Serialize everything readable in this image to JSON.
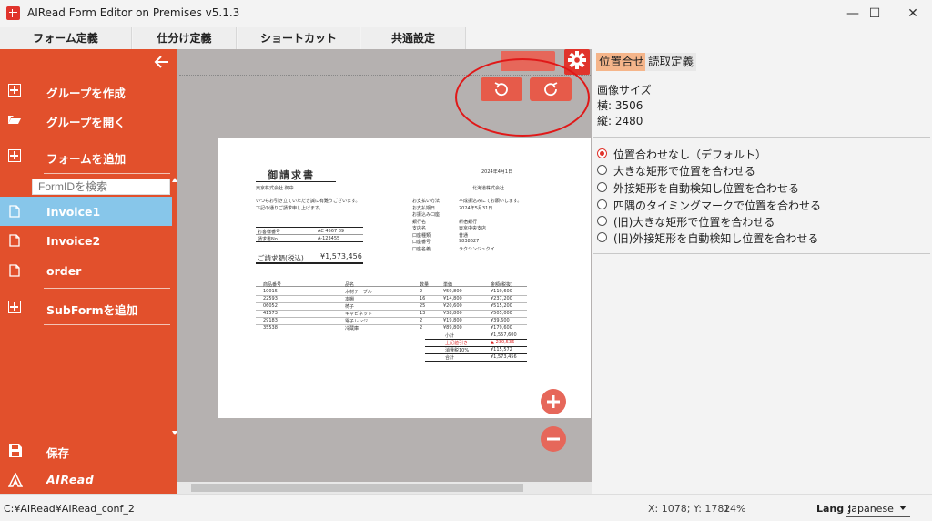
{
  "window": {
    "title": "AIRead Form Editor on Premises v5.1.3",
    "minimize": "—",
    "maximize": "☐",
    "close": "✕"
  },
  "menu": {
    "tabs": [
      "フォーム定義",
      "仕分け定義",
      "ショートカット",
      "共通設定"
    ]
  },
  "sidebar": {
    "back_icon": "arrow-left-icon",
    "items": [
      {
        "label": "グループを作成",
        "icon": "plus-box-icon"
      },
      {
        "label": "グループを開く",
        "icon": "folder-open-icon"
      },
      {
        "label": "フォームを追加",
        "icon": "plus-box-icon"
      },
      {
        "label": "Invoice1",
        "icon": "document-icon"
      },
      {
        "label": "Invoice2",
        "icon": "document-icon"
      },
      {
        "label": "order",
        "icon": "document-icon"
      },
      {
        "label": "SubFormを追加",
        "icon": "plus-box-icon"
      }
    ],
    "search_placeholder": "FormIDを検索",
    "selected": "Invoice1",
    "save_label": "保存",
    "brand": "AIRead"
  },
  "canvas": {
    "rotate_left_icon": "rotate-left-icon",
    "rotate_right_icon": "rotate-right-icon",
    "zoom_in_icon": "plus-circle-icon",
    "zoom_out_icon": "minus-circle-icon",
    "settings_icon": "gear-icon",
    "document": {
      "title": "御請求書",
      "date": "2024年4月1日",
      "customer": "東京株式会社 御中",
      "issuer": "北海道株式会社",
      "greeting": [
        "いつもお引き立ていただき誠に有難うございます。",
        "下記の通りご請求申し上げます。"
      ],
      "meta_left": [
        [
          "お客様番号",
          "AC 4567 89"
        ],
        [
          "請求書No",
          "A-123455"
        ]
      ],
      "meta_right": [
        [
          "お支払い方法",
          "平成振込みにてお願いします。"
        ],
        [
          "お支払期日",
          "2024年5月31日"
        ],
        [
          "お振込み口座",
          ""
        ],
        [
          "銀行名",
          "新宿銀行"
        ],
        [
          "支店名",
          "東京中央支店"
        ],
        [
          "口座種類",
          "普通"
        ],
        [
          "口座番号",
          "9838627"
        ],
        [
          "口座名義",
          "ラクシンジュクイ"
        ]
      ],
      "total_label": "ご請求額(税込)",
      "total_value": "¥1,573,456",
      "table_headers": [
        "商品番号",
        "品名",
        "数量",
        "単価",
        "金額(税抜)"
      ],
      "rows": [
        [
          "10015",
          "木材テーブル",
          "2",
          "¥59,800",
          "¥119,600"
        ],
        [
          "22593",
          "本棚",
          "16",
          "¥14,800",
          "¥237,200"
        ],
        [
          "06052",
          "椅子",
          "25",
          "¥20,600",
          "¥515,200"
        ],
        [
          "41573",
          "キャビネット",
          "13",
          "¥38,800",
          "¥505,000"
        ],
        [
          "29183",
          "電子レンジ",
          "2",
          "¥19,800",
          "¥39,600"
        ],
        [
          "35538",
          "冷蔵庫",
          "2",
          "¥89,800",
          "¥179,600"
        ]
      ],
      "summary": [
        [
          "小計",
          "¥1,557,600"
        ],
        [
          "上記値引き",
          "▲-230,536"
        ],
        [
          "消費税10%",
          "¥115,572"
        ],
        [
          "合計",
          "¥1,573,456"
        ]
      ]
    }
  },
  "right_panel": {
    "tabs": [
      "位置合せ",
      "読取定義"
    ],
    "active_tab": "位置合せ",
    "image_size_label": "画像サイズ",
    "width_text": "横: 3506",
    "height_text": "縦: 2480",
    "options": [
      "位置合わせなし（デフォルト）",
      "大きな矩形で位置を合わせる",
      "外接矩形を自動検知し位置を合わせる",
      "四隅のタイミングマークで位置を合わせる",
      "(旧)大きな矩形で位置を合わせる",
      "(旧)外接矩形を自動検知し位置を合わせる"
    ],
    "selected_option": "位置合わせなし（デフォルト）"
  },
  "status": {
    "path": "C:¥AIRead¥AIRead_conf_2",
    "coords": "X: 1078; Y: 1782",
    "zoom": "14%",
    "lang_label": "Lang :",
    "lang_value": "Japanese"
  },
  "colors": {
    "accent": "#e2502c",
    "selected": "#87c6ea",
    "button": "#e65b4a",
    "highlight": "#e01818"
  }
}
